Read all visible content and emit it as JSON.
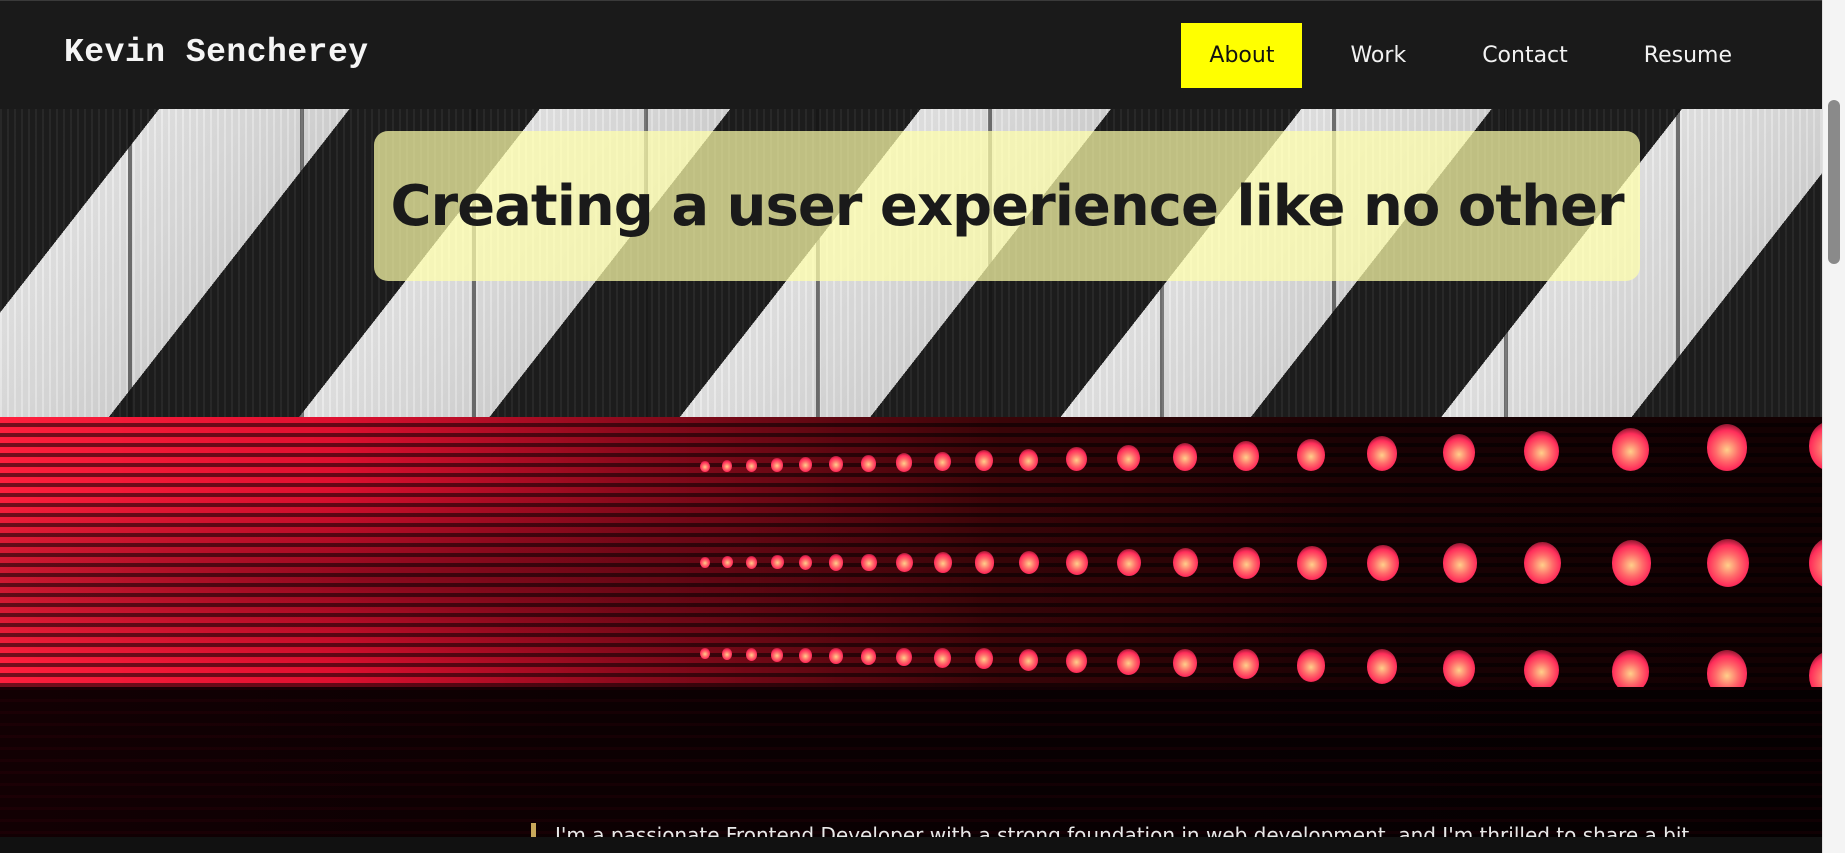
{
  "header": {
    "brand": "Kevin Sencherey",
    "nav": [
      {
        "label": "About",
        "active": true
      },
      {
        "label": "Work",
        "active": false
      },
      {
        "label": "Contact",
        "active": false
      },
      {
        "label": "Resume",
        "active": false
      }
    ]
  },
  "hero": {
    "tagline": "Creating a user experience like no other"
  },
  "intro": {
    "text": "I'm a passionate Frontend Developer with a strong foundation in web development, and I'm thrilled to share a bit"
  },
  "colors": {
    "header_bg": "#1a1a1a",
    "nav_active_bg": "#ffff00",
    "tagline_box": "#ffffaa",
    "accent_red": "#ff1f3d"
  }
}
